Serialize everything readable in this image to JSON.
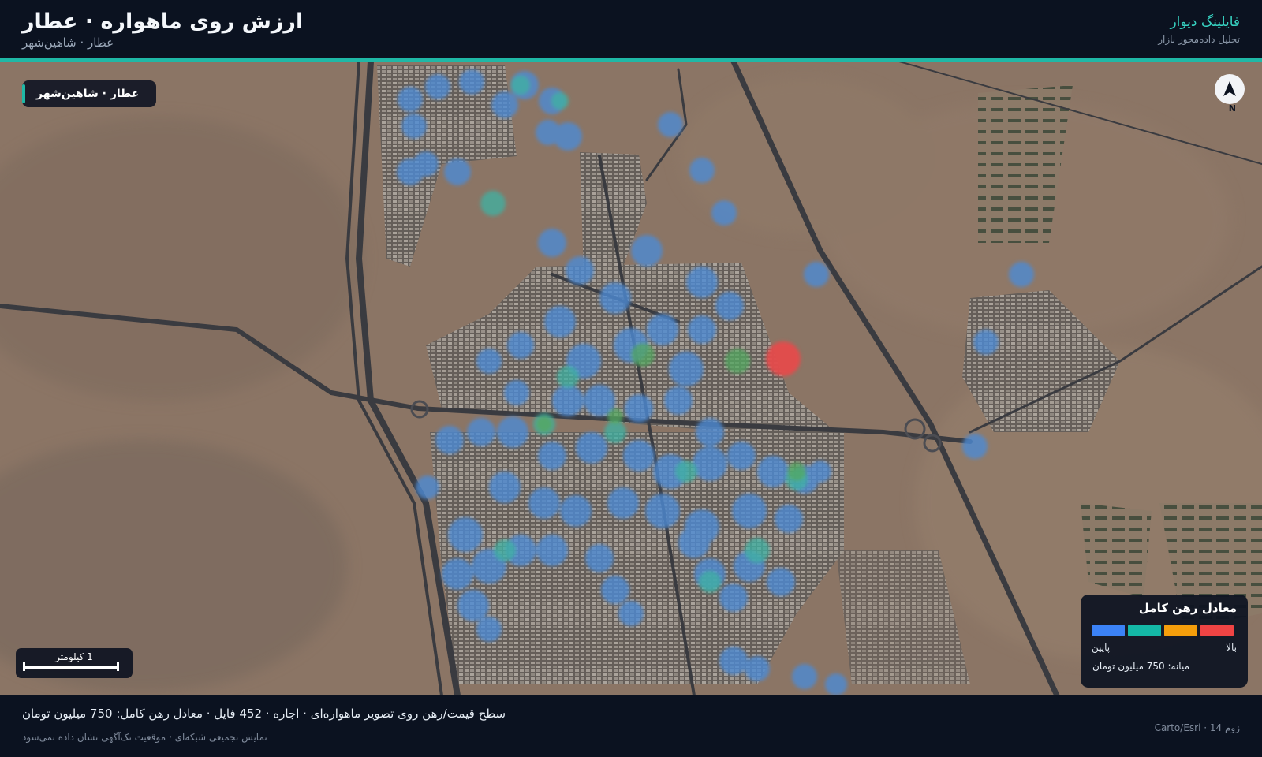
{
  "header": {
    "title": "ارزش روی ماهواره · عطار",
    "subtitle": "عطار · شاهین‌شهر",
    "brand_name": "فایلینگ دیوار",
    "brand_tagline": "تحلیل داده‌محور بازار",
    "accent_color": "#1fb8a6"
  },
  "map": {
    "location_chip": "عطار · شاهین‌شهر",
    "north_label": "N",
    "scale_label": "1 کیلومتر",
    "legend": {
      "title": "معادل رهن کامل",
      "high_label": "بالا",
      "low_label": "پایین",
      "median": "میانه: 750 میلیون تومان",
      "colors": [
        "#3b82f6",
        "#14b8a6",
        "#f59e0b",
        "#ef4444"
      ]
    }
  },
  "footer": {
    "summary": "سطح قیمت/رهن روی تصویر ماهواره‌ای · اجاره · 452 فایل · معادل رهن کامل: 750 میلیون تومان",
    "note": "نمایش تجمیعی شبکه‌ای · موقعیت تک‌آگهی نشان داده نمی‌شود",
    "attribution": "Carto/Esri · زوم 14"
  }
}
